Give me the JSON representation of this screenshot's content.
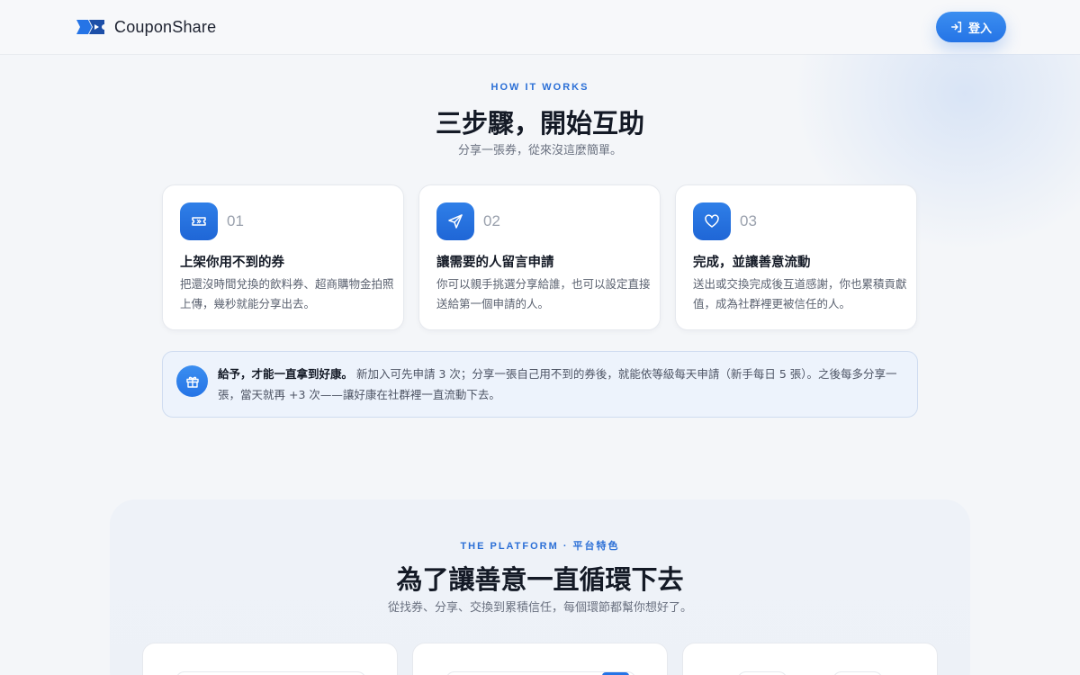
{
  "header": {
    "brand": "CouponShare",
    "login_label": "登入"
  },
  "how_it_works": {
    "eyebrow": "HOW IT WORKS",
    "title": "三步驟，開始互助",
    "subtitle": "分享一張券，從來沒這麼簡單。",
    "steps": [
      {
        "number": "01",
        "icon": "ticket-icon",
        "title": "上架你用不到的券",
        "desc": "把還沒時間兌換的飲料券、超商購物金拍照上傳，幾秒就能分享出去。"
      },
      {
        "number": "02",
        "icon": "send-icon",
        "title": "讓需要的人留言申請",
        "desc": "你可以親手挑選分享給誰，也可以設定直接送給第一個申請的人。"
      },
      {
        "number": "03",
        "icon": "heart-icon",
        "title": "完成，並讓善意流動",
        "desc": "送出或交換完成後互道感謝，你也累積貢獻值，成為社群裡更被信任的人。"
      }
    ],
    "notice": {
      "icon": "gift-icon",
      "lead": "給予，才能一直拿到好康。",
      "body": "新加入可先申請 3 次；分享一張自己用不到的券後，就能依等級每天申請（新手每日 5 張）。之後每多分享一張，當天就再 +3 次——讓好康在社群裡一直流動下去。"
    }
  },
  "platform": {
    "eyebrow": "THE PLATFORM · 平台特色",
    "title": "為了讓善意一直循環下去",
    "subtitle": "從找券、分享、交換到累積信任，每個環節都幫你想好了。"
  },
  "colors": {
    "accent": "#2574e6",
    "eyebrow": "#2b6fd6",
    "background": "#f4f6f9"
  }
}
